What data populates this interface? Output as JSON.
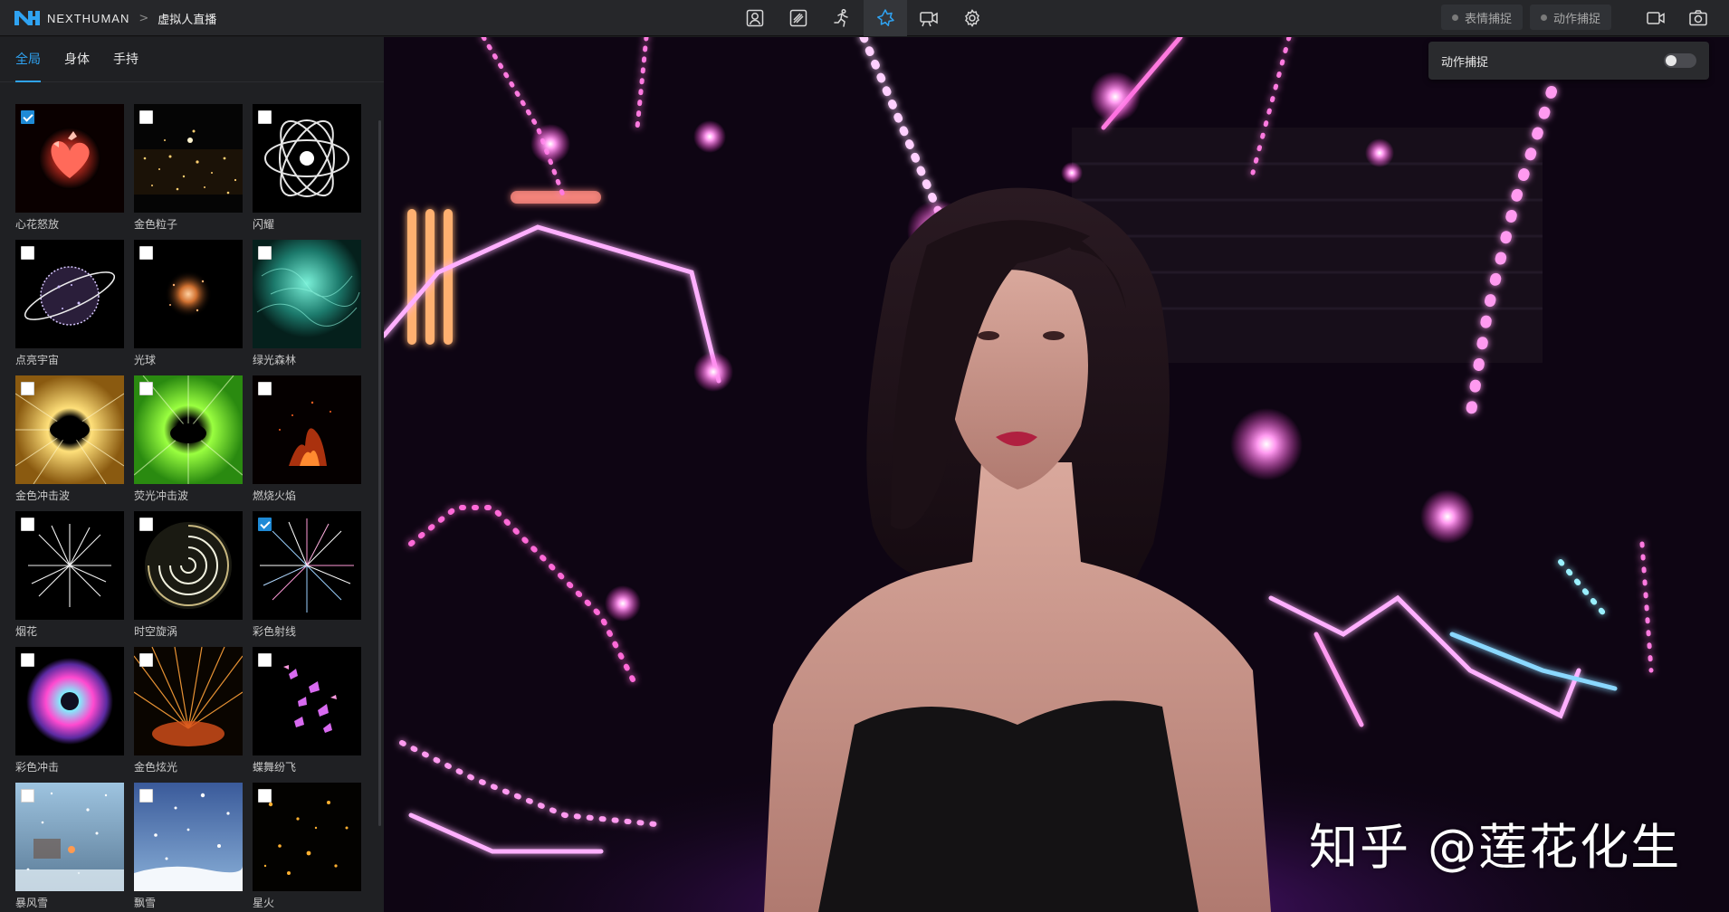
{
  "header": {
    "brand": "NEXTHUMAN",
    "breadcrumb_sep": ">",
    "page_title": "虚拟人直播",
    "capture_buttons": [
      {
        "label": "表情捕捉"
      },
      {
        "label": "动作捕捉"
      }
    ]
  },
  "left_panel": {
    "tabs": [
      {
        "label": "全局",
        "active": true
      },
      {
        "label": "身体",
        "active": false
      },
      {
        "label": "手持",
        "active": false
      }
    ],
    "effects": [
      {
        "label": "心花怒放",
        "checked": true
      },
      {
        "label": "金色粒子",
        "checked": false
      },
      {
        "label": "闪耀",
        "checked": false
      },
      {
        "label": "点亮宇宙",
        "checked": false
      },
      {
        "label": "光球",
        "checked": false
      },
      {
        "label": "绿光森林",
        "checked": false
      },
      {
        "label": "金色冲击波",
        "checked": false
      },
      {
        "label": "荧光冲击波",
        "checked": false
      },
      {
        "label": "燃烧火焰",
        "checked": false
      },
      {
        "label": "烟花",
        "checked": false
      },
      {
        "label": "时空旋涡",
        "checked": false
      },
      {
        "label": "彩色射线",
        "checked": true
      },
      {
        "label": "彩色冲击",
        "checked": false
      },
      {
        "label": "金色炫光",
        "checked": false
      },
      {
        "label": "蝶舞纷飞",
        "checked": false
      },
      {
        "label": "暴风雪",
        "checked": false
      },
      {
        "label": "飘雪",
        "checked": false
      },
      {
        "label": "星火",
        "checked": false
      }
    ]
  },
  "viewport": {
    "motion_capture_panel": {
      "label": "动作捕捉",
      "enabled": false
    },
    "watermark": "知乎 @莲花化生"
  },
  "colors": {
    "accent": "#2fa3f2",
    "checkbox_checked": "#1e8ad6",
    "neon_pink": "#ff3ad8",
    "neon_purple": "#b05bff"
  }
}
